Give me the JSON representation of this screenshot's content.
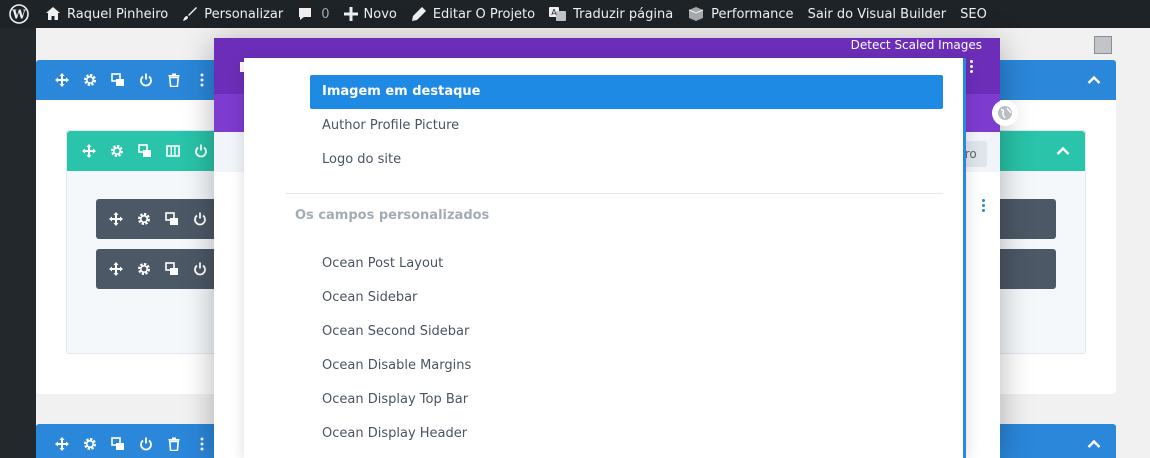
{
  "adminbar": {
    "user_name": "Raquel Pinheiro",
    "customize": "Personalizar",
    "comments_count": "0",
    "new": "Novo",
    "edit_project": "Editar O Projeto",
    "translate": "Traduzir página",
    "performance": "Performance",
    "exit_builder": "Sair do Visual Builder",
    "seo": "SEO"
  },
  "modal": {
    "detect_label": "Detect Scaled Images",
    "filter_partial": "tro"
  },
  "dropdown": {
    "items": [
      "Imagem em destaque",
      "Author Profile Picture",
      "Logo do site"
    ],
    "group_label": "Os campos personalizados",
    "custom_fields": [
      "Ocean Post Layout",
      "Ocean Sidebar",
      "Ocean Second Sidebar",
      "Ocean Disable Margins",
      "Ocean Display Top Bar",
      "Ocean Display Header"
    ]
  },
  "colors": {
    "section": "#2b87da",
    "row": "#29c4a9",
    "module": "#4c5866",
    "modal_header": "#6c2eb9",
    "dropdown_active": "#1f8ae3"
  }
}
